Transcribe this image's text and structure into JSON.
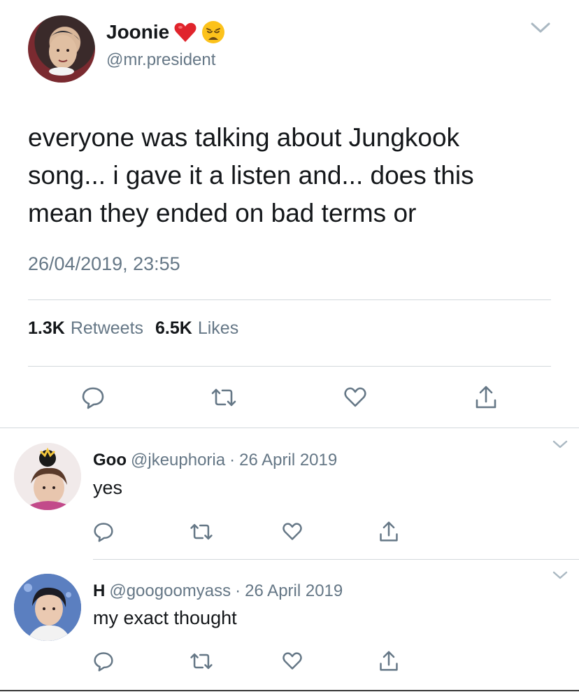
{
  "tweet": {
    "display_name": "Joonie",
    "emoji": [
      "❤️",
      "😩"
    ],
    "handle": "@mr.president",
    "text_lines": [
      "everyone was talking about Jungkook",
      "song... i gave it a listen and... does this",
      "mean they ended on bad terms or"
    ],
    "timestamp": "26/04/2019, 23:55",
    "retweets_count": "1.3K",
    "retweets_label": "Retweets",
    "likes_count": "6.5K",
    "likes_label": "Likes",
    "actions": [
      "reply-icon",
      "retweet-icon",
      "like-icon",
      "share-icon"
    ]
  },
  "replies": [
    {
      "name": "Goo",
      "handle": "@jkeuphoria",
      "separator": "·",
      "date": "26 April 2019",
      "text": "yes"
    },
    {
      "name": "H",
      "handle": "@googoomyass",
      "separator": "·",
      "date": "26 April 2019",
      "text": "my exact thought"
    }
  ],
  "colors": {
    "text": "#14171a",
    "secondary": "#657786",
    "divider": "#d3d8dc",
    "icon": "#657786"
  }
}
